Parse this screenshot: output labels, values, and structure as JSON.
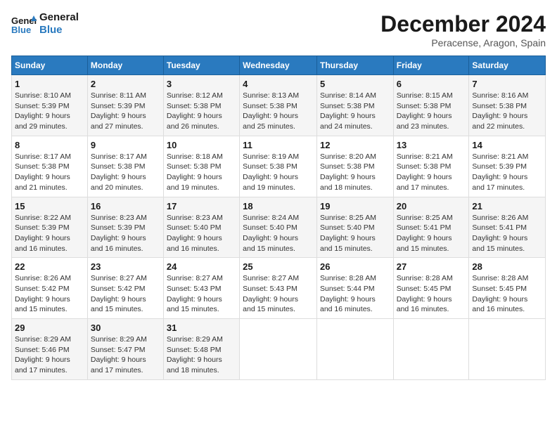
{
  "logo": {
    "line1": "General",
    "line2": "Blue"
  },
  "title": "December 2024",
  "subtitle": "Peracense, Aragon, Spain",
  "days_of_week": [
    "Sunday",
    "Monday",
    "Tuesday",
    "Wednesday",
    "Thursday",
    "Friday",
    "Saturday"
  ],
  "weeks": [
    [
      {
        "day": "1",
        "info": "Sunrise: 8:10 AM\nSunset: 5:39 PM\nDaylight: 9 hours\nand 29 minutes."
      },
      {
        "day": "2",
        "info": "Sunrise: 8:11 AM\nSunset: 5:39 PM\nDaylight: 9 hours\nand 27 minutes."
      },
      {
        "day": "3",
        "info": "Sunrise: 8:12 AM\nSunset: 5:38 PM\nDaylight: 9 hours\nand 26 minutes."
      },
      {
        "day": "4",
        "info": "Sunrise: 8:13 AM\nSunset: 5:38 PM\nDaylight: 9 hours\nand 25 minutes."
      },
      {
        "day": "5",
        "info": "Sunrise: 8:14 AM\nSunset: 5:38 PM\nDaylight: 9 hours\nand 24 minutes."
      },
      {
        "day": "6",
        "info": "Sunrise: 8:15 AM\nSunset: 5:38 PM\nDaylight: 9 hours\nand 23 minutes."
      },
      {
        "day": "7",
        "info": "Sunrise: 8:16 AM\nSunset: 5:38 PM\nDaylight: 9 hours\nand 22 minutes."
      }
    ],
    [
      {
        "day": "8",
        "info": "Sunrise: 8:17 AM\nSunset: 5:38 PM\nDaylight: 9 hours\nand 21 minutes."
      },
      {
        "day": "9",
        "info": "Sunrise: 8:17 AM\nSunset: 5:38 PM\nDaylight: 9 hours\nand 20 minutes."
      },
      {
        "day": "10",
        "info": "Sunrise: 8:18 AM\nSunset: 5:38 PM\nDaylight: 9 hours\nand 19 minutes."
      },
      {
        "day": "11",
        "info": "Sunrise: 8:19 AM\nSunset: 5:38 PM\nDaylight: 9 hours\nand 19 minutes."
      },
      {
        "day": "12",
        "info": "Sunrise: 8:20 AM\nSunset: 5:38 PM\nDaylight: 9 hours\nand 18 minutes."
      },
      {
        "day": "13",
        "info": "Sunrise: 8:21 AM\nSunset: 5:38 PM\nDaylight: 9 hours\nand 17 minutes."
      },
      {
        "day": "14",
        "info": "Sunrise: 8:21 AM\nSunset: 5:39 PM\nDaylight: 9 hours\nand 17 minutes."
      }
    ],
    [
      {
        "day": "15",
        "info": "Sunrise: 8:22 AM\nSunset: 5:39 PM\nDaylight: 9 hours\nand 16 minutes."
      },
      {
        "day": "16",
        "info": "Sunrise: 8:23 AM\nSunset: 5:39 PM\nDaylight: 9 hours\nand 16 minutes."
      },
      {
        "day": "17",
        "info": "Sunrise: 8:23 AM\nSunset: 5:40 PM\nDaylight: 9 hours\nand 16 minutes."
      },
      {
        "day": "18",
        "info": "Sunrise: 8:24 AM\nSunset: 5:40 PM\nDaylight: 9 hours\nand 15 minutes."
      },
      {
        "day": "19",
        "info": "Sunrise: 8:25 AM\nSunset: 5:40 PM\nDaylight: 9 hours\nand 15 minutes."
      },
      {
        "day": "20",
        "info": "Sunrise: 8:25 AM\nSunset: 5:41 PM\nDaylight: 9 hours\nand 15 minutes."
      },
      {
        "day": "21",
        "info": "Sunrise: 8:26 AM\nSunset: 5:41 PM\nDaylight: 9 hours\nand 15 minutes."
      }
    ],
    [
      {
        "day": "22",
        "info": "Sunrise: 8:26 AM\nSunset: 5:42 PM\nDaylight: 9 hours\nand 15 minutes."
      },
      {
        "day": "23",
        "info": "Sunrise: 8:27 AM\nSunset: 5:42 PM\nDaylight: 9 hours\nand 15 minutes."
      },
      {
        "day": "24",
        "info": "Sunrise: 8:27 AM\nSunset: 5:43 PM\nDaylight: 9 hours\nand 15 minutes."
      },
      {
        "day": "25",
        "info": "Sunrise: 8:27 AM\nSunset: 5:43 PM\nDaylight: 9 hours\nand 15 minutes."
      },
      {
        "day": "26",
        "info": "Sunrise: 8:28 AM\nSunset: 5:44 PM\nDaylight: 9 hours\nand 16 minutes."
      },
      {
        "day": "27",
        "info": "Sunrise: 8:28 AM\nSunset: 5:45 PM\nDaylight: 9 hours\nand 16 minutes."
      },
      {
        "day": "28",
        "info": "Sunrise: 8:28 AM\nSunset: 5:45 PM\nDaylight: 9 hours\nand 16 minutes."
      }
    ],
    [
      {
        "day": "29",
        "info": "Sunrise: 8:29 AM\nSunset: 5:46 PM\nDaylight: 9 hours\nand 17 minutes."
      },
      {
        "day": "30",
        "info": "Sunrise: 8:29 AM\nSunset: 5:47 PM\nDaylight: 9 hours\nand 17 minutes."
      },
      {
        "day": "31",
        "info": "Sunrise: 8:29 AM\nSunset: 5:48 PM\nDaylight: 9 hours\nand 18 minutes."
      },
      {
        "day": "",
        "info": ""
      },
      {
        "day": "",
        "info": ""
      },
      {
        "day": "",
        "info": ""
      },
      {
        "day": "",
        "info": ""
      }
    ]
  ]
}
